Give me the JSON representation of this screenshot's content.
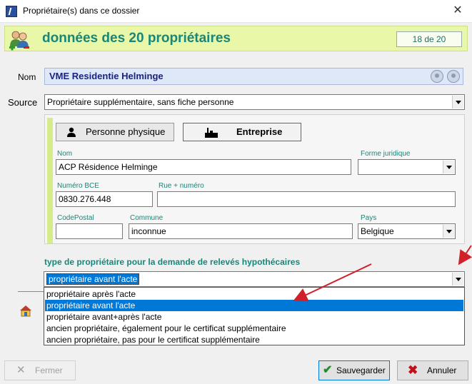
{
  "window": {
    "title": "Propriétaire(s) dans ce dossier"
  },
  "header": {
    "title": "données des 20 propriétaires",
    "counter": "18 de 20"
  },
  "nom": {
    "label": "Nom",
    "value": "VME Residentie Helminge"
  },
  "source": {
    "label": "Source",
    "value": "Propriétaire supplémentaire, sans fiche personne"
  },
  "tabs": [
    {
      "label": "Personne physique"
    },
    {
      "label": "Entreprise",
      "active": true
    }
  ],
  "entreprise": {
    "nom_label": "Nom",
    "nom_value": "ACP Résidence Helminge",
    "forme_label": "Forme juridique",
    "forme_value": "",
    "bce_label": "Numéro BCE",
    "bce_value": "0830.276.448",
    "rue_label": "Rue + numéro",
    "rue_value": "",
    "cp_label": "CodePostal",
    "cp_value": "",
    "commune_label": "Commune",
    "commune_value": "inconnue",
    "pays_label": "Pays",
    "pays_value": "Belgique"
  },
  "type": {
    "label": "type de propriétaire pour la demande de relevés hypothécaires",
    "value": "propriétaire avant l'acte",
    "options": [
      "propriétaire après l'acte",
      "propriétaire avant l'acte",
      "propriétaire avant+après l'acte",
      "ancien propriétaire, également pour le certificat supplémentaire",
      "ancien propriétaire, pas pour le certificat supplémentaire"
    ],
    "selected_index": 1
  },
  "buttons": {
    "fermer": "Fermer",
    "sauvegarder": "Sauvegarder",
    "annuler": "Annuler"
  },
  "colors": {
    "accent": "#16877a",
    "header_bg": "#e9f7a8",
    "selection": "#0078d7",
    "arrow": "#d0202a"
  }
}
